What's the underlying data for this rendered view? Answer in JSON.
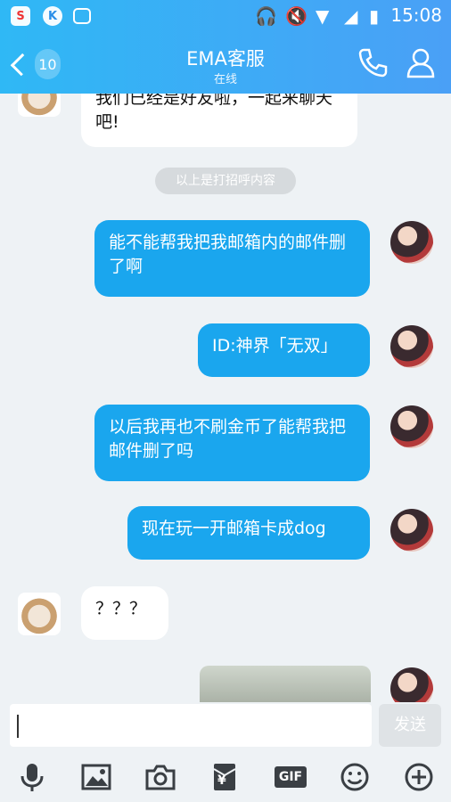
{
  "status_bar": {
    "time": "15:08",
    "left_icons": [
      "sohu-icon",
      "k-app-icon",
      "image-icon"
    ],
    "right_icons": [
      "headphone-icon",
      "mute-icon",
      "wifi-icon",
      "signal-icon",
      "battery-icon"
    ]
  },
  "header": {
    "back_badge": "10",
    "title": "EMA客服",
    "subtitle": "在线",
    "accent": "#2fb8f5"
  },
  "messages": [
    {
      "from": "them",
      "text": "我们已经是好友啦，一起来聊天吧!"
    },
    {
      "from": "system",
      "text": "以上是打招呼内容"
    },
    {
      "from": "me",
      "text": "能不能帮我把我邮箱内的邮件删了啊"
    },
    {
      "from": "me",
      "text": "ID:神界「无双」"
    },
    {
      "from": "me",
      "text": "以后我再也不刷金币了能帮我把邮件删了吗"
    },
    {
      "from": "me",
      "text": "现在玩一开邮箱卡成dog"
    },
    {
      "from": "them",
      "text": "？？？"
    }
  ],
  "input": {
    "placeholder": "",
    "send_label": "发送"
  },
  "toolbar": {
    "items": [
      "mic-icon",
      "picture-icon",
      "camera-icon",
      "red-packet-icon",
      "gif-icon",
      "emoji-icon",
      "plus-icon"
    ],
    "gif_label": "GIF",
    "yen_label": "¥"
  }
}
